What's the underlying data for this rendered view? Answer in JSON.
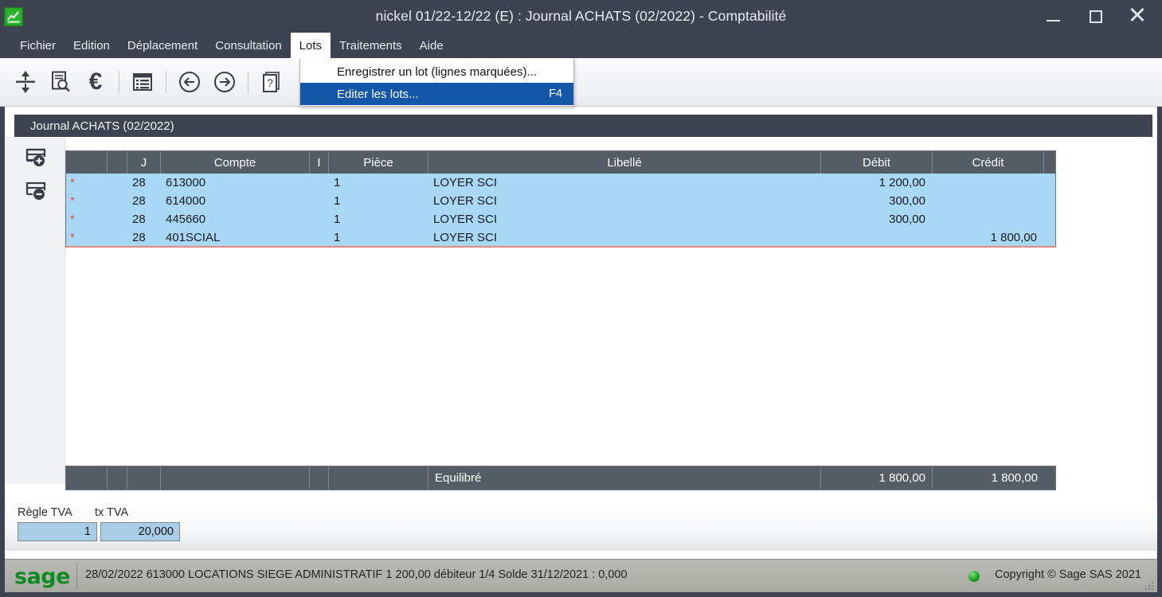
{
  "window": {
    "title": "nickel  01/22-12/22 (E) : Journal ACHATS (02/2022)  - Comptabilité",
    "app_icon": "chart-app-icon",
    "minimize_label": "–",
    "maximize_label": "□",
    "close_label": "✕"
  },
  "menubar": {
    "items": [
      {
        "label": "Fichier"
      },
      {
        "label": "Edition"
      },
      {
        "label": "Déplacement"
      },
      {
        "label": "Consultation"
      },
      {
        "label": "Lots"
      },
      {
        "label": "Traitements"
      },
      {
        "label": "Aide"
      }
    ],
    "open_index": 4
  },
  "dropdown": {
    "items": [
      {
        "label": "Enregistrer un lot (lignes marquées)...",
        "accel": "",
        "selected": false
      },
      {
        "label": "Editer les lots...",
        "accel": "F4",
        "selected": true
      }
    ]
  },
  "toolbar": {
    "buttons": [
      {
        "name": "split-lines-icon",
        "glyph": "split"
      },
      {
        "name": "document-search-icon",
        "glyph": "doc-search"
      },
      {
        "name": "euro-icon",
        "glyph": "€"
      },
      {
        "name": "separator",
        "glyph": "sep"
      },
      {
        "name": "list-view-icon",
        "glyph": "list"
      },
      {
        "name": "separator",
        "glyph": "sep"
      },
      {
        "name": "previous-arrow-icon",
        "glyph": "back"
      },
      {
        "name": "next-arrow-icon",
        "glyph": "forward"
      },
      {
        "name": "separator",
        "glyph": "sep"
      },
      {
        "name": "help-icon",
        "glyph": "help"
      }
    ]
  },
  "journal": {
    "caption": "Journal ACHATS (02/2022)"
  },
  "gutter": {
    "add_label": "insert-line",
    "delete_label": "delete-line"
  },
  "grid": {
    "columns": [
      {
        "key": "mark",
        "label": ""
      },
      {
        "key": "blank",
        "label": ""
      },
      {
        "key": "j",
        "label": "J"
      },
      {
        "key": "compte",
        "label": "Compte"
      },
      {
        "key": "i",
        "label": "I"
      },
      {
        "key": "piece",
        "label": "Pièce"
      },
      {
        "key": "lib",
        "label": "Libellé"
      },
      {
        "key": "deb",
        "label": "Débit"
      },
      {
        "key": "cred",
        "label": "Crédit"
      }
    ],
    "rows": [
      {
        "mark": "*",
        "blank": "",
        "j": "28",
        "compte": "613000",
        "i": "",
        "piece": "1",
        "lib": "LOYER SCI",
        "deb": "1 200,00",
        "cred": ""
      },
      {
        "mark": "*",
        "blank": "",
        "j": "28",
        "compte": "614000",
        "i": "",
        "piece": "1",
        "lib": "LOYER SCI",
        "deb": "300,00",
        "cred": ""
      },
      {
        "mark": "*",
        "blank": "",
        "j": "28",
        "compte": "445660",
        "i": "",
        "piece": "1",
        "lib": "LOYER SCI",
        "deb": "300,00",
        "cred": ""
      },
      {
        "mark": "*",
        "blank": "",
        "j": "28",
        "compte": "401SCIAL",
        "i": "",
        "piece": "1",
        "lib": "LOYER SCI",
        "deb": "",
        "cred": "1 800,00"
      }
    ],
    "total_row": {
      "mark": "",
      "blank": "",
      "j": "",
      "compte": "",
      "i": "",
      "piece": "",
      "lib": "Equilibré",
      "deb": "1 800,00",
      "cred": "1 800,00"
    }
  },
  "tva": {
    "regle_label": "Règle TVA",
    "regle_value": "1",
    "tx_label": "tx TVA",
    "tx_value": "20,000"
  },
  "statusbar": {
    "logo": "sage",
    "info": "28/02/2022 613000 LOCATIONS SIEGE ADMINISTRATIF   1 200,00 débiteur      1/4      Solde 31/12/2021 : 0,000",
    "copyright": "Copyright © Sage SAS 2021",
    "led": "status-led-green"
  },
  "colors": {
    "chrome": "#3d4350",
    "grid_header": "#545c66",
    "row_selected": "#a8d8f5",
    "menu_highlight": "#1456a8",
    "mark_red": "#d9534f",
    "sage_green": "#0f8a23"
  }
}
